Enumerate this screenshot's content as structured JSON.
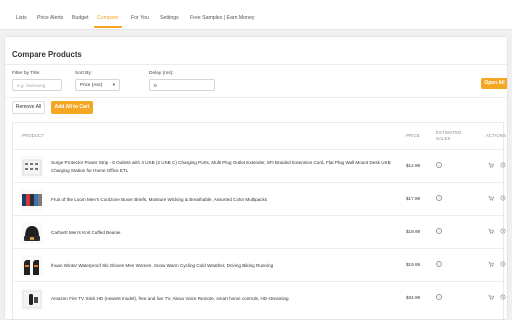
{
  "nav": {
    "tabs": [
      {
        "label": "Lists"
      },
      {
        "label": "Price Alerts"
      },
      {
        "label": "Budget"
      },
      {
        "label": "Compare"
      },
      {
        "label": "For You"
      },
      {
        "label": "Settings"
      },
      {
        "label": "Free Samples | Earn Money"
      }
    ],
    "active_tab": "Compare"
  },
  "page": {
    "title": "Compare Products"
  },
  "filters": {
    "title_label": "Filter by Title:",
    "title_placeholder": "e.g. Samsung",
    "title_value": "",
    "sort_label": "Sort By:",
    "sort_value": "Price (Asc)",
    "delay_label": "Delay (ms):",
    "delay_value": "0",
    "open_all_label": "Open All"
  },
  "actions": {
    "remove_all_label": "Remove All",
    "add_all_label": "Add All to Cart"
  },
  "table": {
    "headers": {
      "product": "PRODUCT",
      "price": "PRICE",
      "estimated_sales": "ESTIMATED SALES",
      "actions": "ACTIONS"
    },
    "rows": [
      {
        "name": "Surge Protector Power Strip - 8 Outlets with 4 USB (2 USB C) Charging Ports, Multi Plug Outlet Extender, 5Ft Braided Extension Cord, Flat Plug Wall Mount Desk USB Charging Station for Home Office ETL",
        "price": "$12.99"
      },
      {
        "name": "Fruit of the Loom Men's Coolzone Boxer Briefs, Moisture Wicking & Breathable, Assorted Color Multipacks",
        "price": "$17.99"
      },
      {
        "name": "Carhartt Men's Knit Cuffed Beanie",
        "price": "$19.99"
      },
      {
        "name": "Ihuan Winter Waterproof Ski Gloves Men Women, Snow Warm Cycling Cold Weather, Driving Biking Running",
        "price": "$19.99"
      },
      {
        "name": "Amazon Fire TV Stick HD (newest model), free and live TV, Alexa Voice Remote, smart home controls, HD streaming",
        "price": "$34.99"
      }
    ]
  },
  "colors": {
    "accent": "#f5a623",
    "background": "#f0f0f0"
  },
  "icons": [
    "info-icon",
    "cart-icon",
    "history-icon"
  ]
}
